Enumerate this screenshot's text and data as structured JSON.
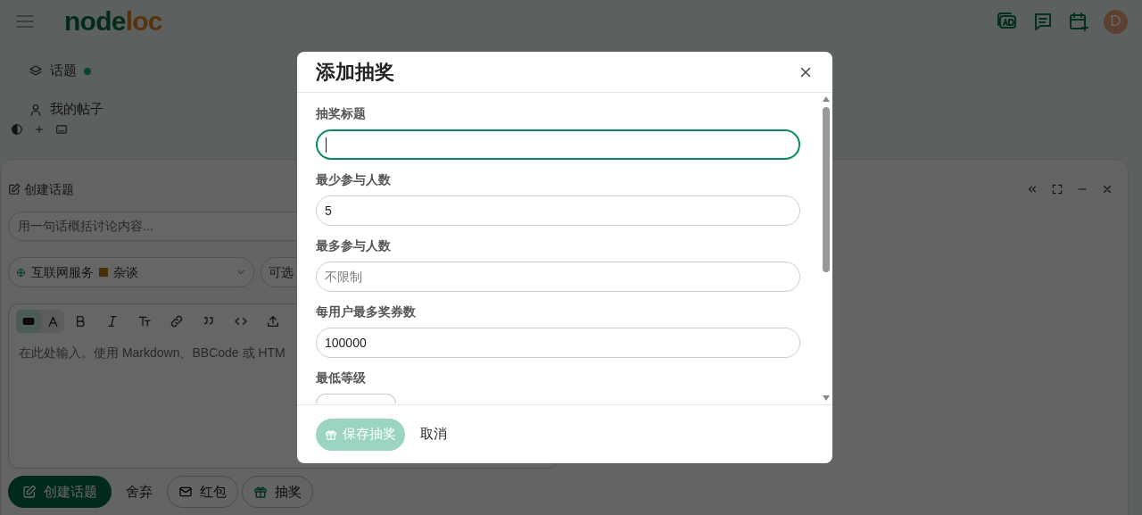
{
  "header": {
    "logo_parts": [
      "node",
      "loc"
    ],
    "avatar": "D"
  },
  "sidebar": {
    "items": [
      {
        "label": "话题",
        "unread_dot": true
      },
      {
        "label": "我的帖子",
        "unread_dot": false
      }
    ]
  },
  "composer": {
    "title": "创建话题",
    "title_placeholder": "用一句话概括讨论内容...",
    "category": "互联网服务",
    "subcategory": "杂谈",
    "tags_placeholder": "可选",
    "markdown_mode": true,
    "editor_placeholder": "在此处输入。使用 Markdown、BBCode 或 HTM",
    "buttons": [
      {
        "kind": "primary",
        "label": "创建话题"
      },
      {
        "kind": "plain",
        "label": "舍弃"
      },
      {
        "kind": "envelope",
        "label": "红包"
      },
      {
        "kind": "gift",
        "label": "抽奖"
      }
    ]
  },
  "dialog": {
    "title": "添加抽奖",
    "fields": [
      {
        "label": "抽奖标题",
        "kind": "text",
        "focused": true
      },
      {
        "label": "最少参与人数",
        "kind": "text",
        "value": "5",
        "focused": false
      },
      {
        "label": "最多参与人数",
        "kind": "text",
        "placeholder": "不限制",
        "focused": false
      },
      {
        "label": "每用户最多奖券数",
        "kind": "text",
        "value": "100000",
        "focused": false
      },
      {
        "label": "最低等级",
        "kind": "select",
        "focused": false
      }
    ],
    "save_button": {
      "label": "保存抽奖",
      "disabled": true
    },
    "cancel_button": "取消"
  }
}
